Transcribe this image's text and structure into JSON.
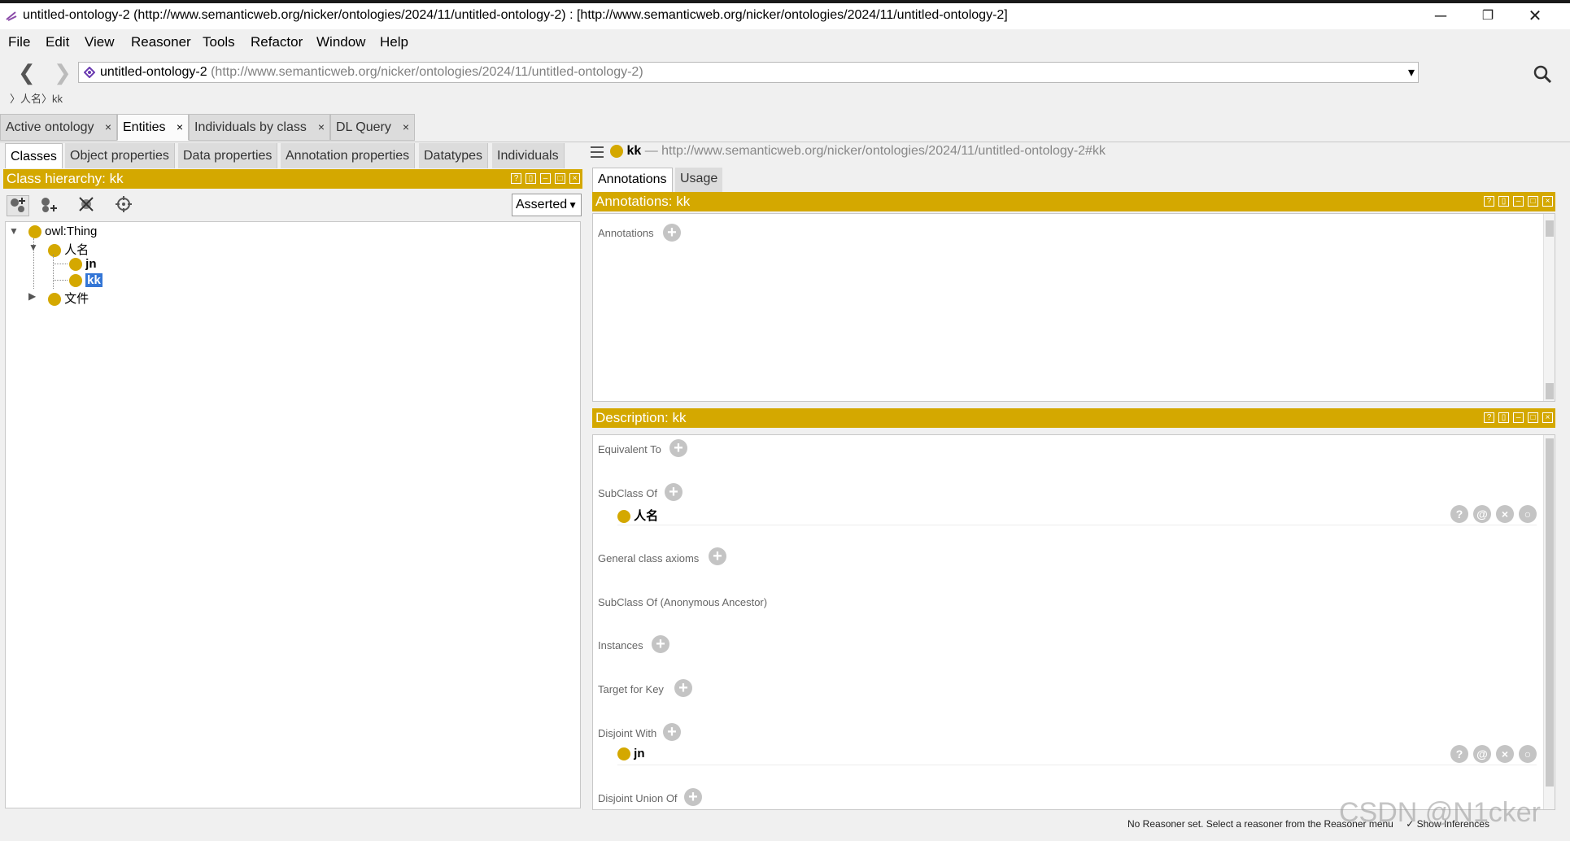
{
  "window": {
    "title": "untitled-ontology-2 (http://www.semanticweb.org/nicker/ontologies/2024/11/untitled-ontology-2)  : [http://www.semanticweb.org/nicker/ontologies/2024/11/untitled-ontology-2]",
    "minimize": "─",
    "restore": "❐",
    "close": "✕"
  },
  "menu": {
    "items": [
      {
        "label": "File"
      },
      {
        "label": "Edit"
      },
      {
        "label": "View"
      },
      {
        "label": "Reasoner"
      },
      {
        "label": "Tools"
      },
      {
        "label": "Refactor"
      },
      {
        "label": "Window"
      },
      {
        "label": "Help"
      }
    ]
  },
  "nav": {
    "back": "❮",
    "forward": "❯",
    "ontology_name": "untitled-ontology-2",
    "ontology_uri": "(http://www.semanticweb.org/nicker/ontologies/2024/11/untitled-ontology-2)",
    "dropdown": "▾",
    "breadcrumb": "〉人名〉kk"
  },
  "tabs": [
    {
      "label": "Active ontology",
      "close": "×"
    },
    {
      "label": "Entities",
      "close": "×"
    },
    {
      "label": "Individuals by class",
      "close": "×"
    },
    {
      "label": "DL Query",
      "close": "×"
    }
  ],
  "entity_tabs": [
    {
      "label": "Classes"
    },
    {
      "label": "Object properties"
    },
    {
      "label": "Data properties"
    },
    {
      "label": "Annotation properties"
    },
    {
      "label": "Datatypes"
    },
    {
      "label": "Individuals"
    }
  ],
  "class_hierarchy": {
    "title": "Class hierarchy: kk",
    "mode": "Asserted",
    "tree": {
      "root": "owl:Thing",
      "level1_a": "人名",
      "child_jn": "jn",
      "child_kk": "kk",
      "level1_b": "文件"
    }
  },
  "entity": {
    "name": "kk",
    "uri": "— http://www.semanticweb.org/nicker/ontologies/2024/11/untitled-ontology-2#kk"
  },
  "right_tabs": [
    {
      "label": "Annotations"
    },
    {
      "label": "Usage"
    }
  ],
  "annotations": {
    "title": "Annotations: kk",
    "label": "Annotations"
  },
  "description": {
    "title": "Description: kk",
    "sections": {
      "equivalent": "Equivalent To",
      "subclass": "SubClass Of",
      "subclass_item": "人名",
      "general": "General class axioms",
      "anon": "SubClass Of (Anonymous Ancestor)",
      "instances": "Instances",
      "target": "Target for Key",
      "disjoint": "Disjoint With",
      "disjoint_item": "jn",
      "disjoint_union": "Disjoint Union Of"
    }
  },
  "status": {
    "text": "No Reasoner set. Select a reasoner from the Reasoner menu",
    "show_inferences": "Show Inferences"
  },
  "watermark": "CSDN @N1cker"
}
